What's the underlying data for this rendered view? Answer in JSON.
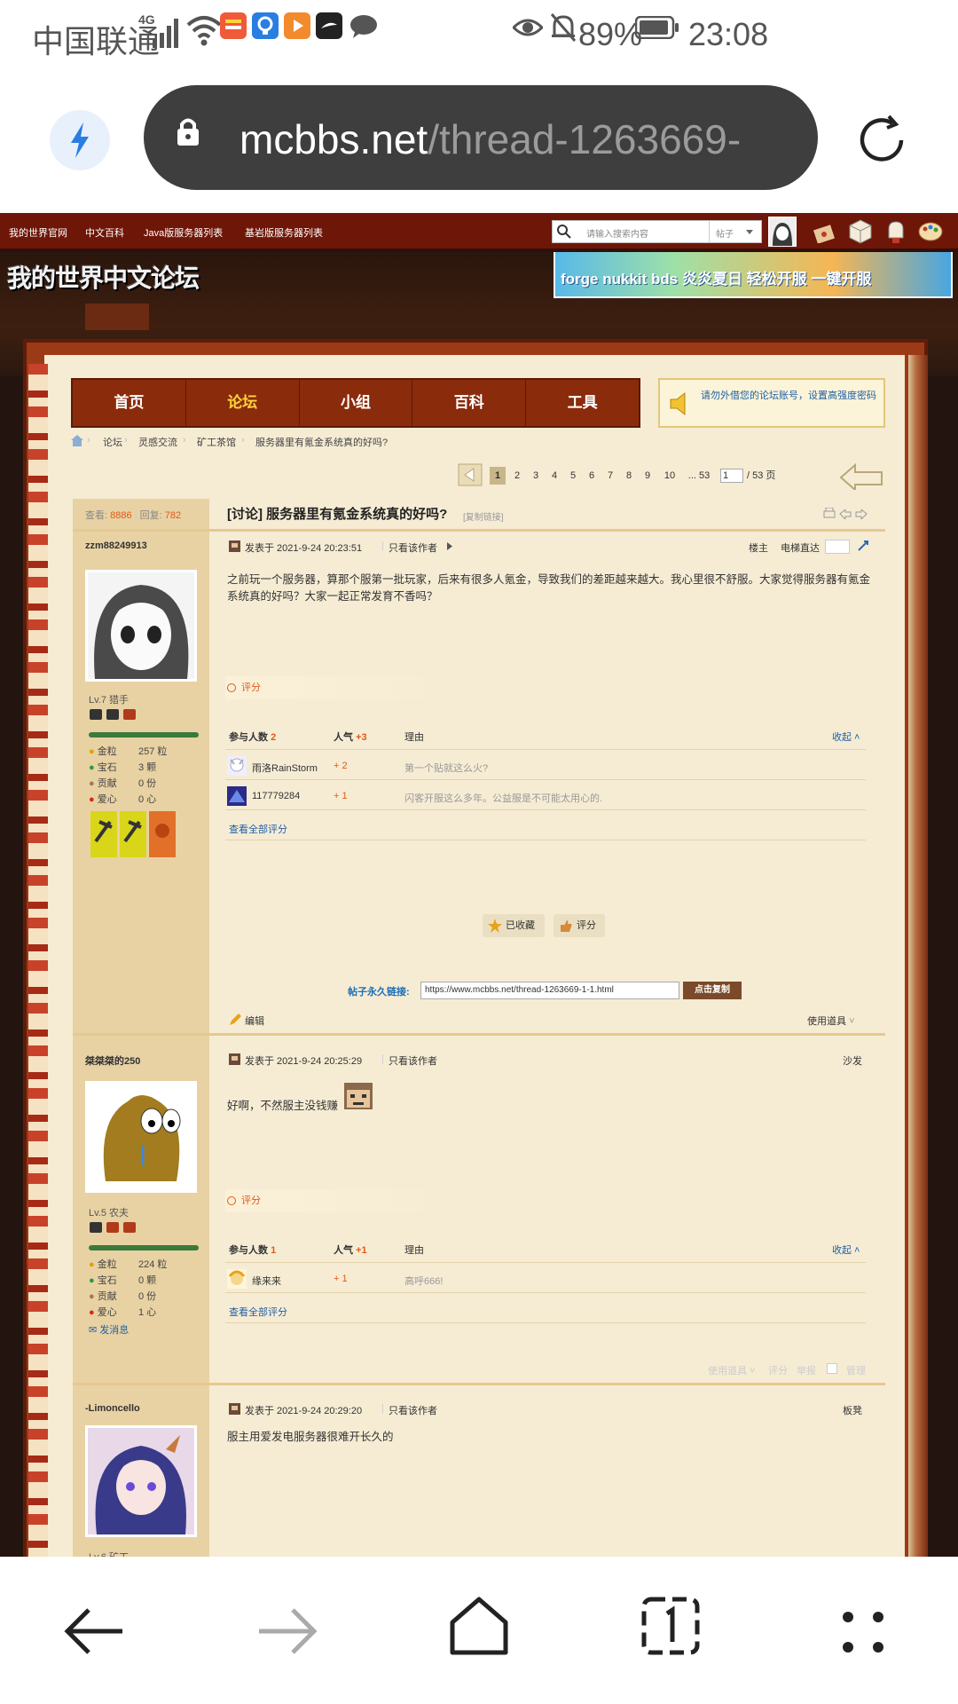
{
  "status_bar": {
    "carrier": "中国联通",
    "network": "4G",
    "battery": "89%",
    "time": "23:08",
    "icons": [
      "signal-icon",
      "wifi-icon",
      "app-icon-red",
      "app-icon-blue",
      "app-icon-orange",
      "app-icon-black",
      "chat-icon",
      "eye-icon",
      "mute-bell-icon",
      "battery-icon"
    ]
  },
  "browser": {
    "url_host": "mcbbs.net",
    "url_path": "/thread-1263669-"
  },
  "site": {
    "top_links": [
      "我的世界官网",
      "中文百科",
      "Java版服务器列表",
      "基岩版服务器列表"
    ],
    "search_placeholder": "请输入搜索内容",
    "search_scope": "帖子",
    "logo_text": "我的世界中文论坛",
    "banner_text": "forge nukkit bds 炎炎夏日 轻松开服 一键开服",
    "menu": [
      "首页",
      "论坛",
      "小组",
      "百科",
      "工具"
    ],
    "active_menu": "论坛",
    "password_tip": "请勿外借您的论坛账号，设置高强度密码",
    "breadcrumb": [
      "论坛",
      "灵感交流",
      "矿工茶馆",
      "服务器里有氪金系统真的好吗?"
    ],
    "pages": [
      "1",
      "2",
      "3",
      "4",
      "5",
      "6",
      "7",
      "8",
      "9",
      "10",
      "... 53"
    ],
    "page_input": "1",
    "page_total": "/ 53 页"
  },
  "thread": {
    "views_label": "查看:",
    "views": "8886",
    "replies_label": "回复:",
    "replies": "782",
    "title": "[讨论] 服务器里有氪金系统真的好吗?",
    "copy_link": "[复制链接]",
    "permalink_label": "帖子永久链接:",
    "permalink": "https://www.mcbbs.net/thread-1263669-1-1.html",
    "copy_button": "点击复制",
    "favorite_button": "已收藏",
    "rate_button": "评分",
    "edit_label": "编辑",
    "use_tool": "使用道具",
    "jump_label": "电梯直达"
  },
  "posts": [
    {
      "author": "zzm88249913",
      "rank": "Lv.7 猎手",
      "stats": [
        {
          "label": "金粒",
          "value": "257 粒"
        },
        {
          "label": "宝石",
          "value": "3 颗"
        },
        {
          "label": "贡献",
          "value": "0 份"
        },
        {
          "label": "爱心",
          "value": "0 心"
        }
      ],
      "meta": "发表于 2021-9-24 20:23:51",
      "only_author": "只看该作者",
      "floor": "楼主",
      "content": "之前玩一个服务器，算那个服第一批玩家，后来有很多人氪金，导致我们的差距越来越大。我心里很不舒服。大家觉得服务器有氪金系统真的好吗？大家一起正常发育不香吗？",
      "rating_title": "评分",
      "rating_cols": [
        "参与人数",
        "人气",
        "理由"
      ],
      "rating_count": "2",
      "rating_pop": "+3",
      "collapse": "收起",
      "ratings": [
        {
          "user": "雨洛RainStorm",
          "pop": "+ 2",
          "reason": "第一个贴就这么火?"
        },
        {
          "user": "117779284",
          "pop": "+ 1",
          "reason": "闪客开服这么多年。公益服是不可能太用心的."
        }
      ],
      "view_all": "查看全部评分"
    },
    {
      "author": "桀桀桀的250",
      "rank": "Lv.5 农夫",
      "stats": [
        {
          "label": "金粒",
          "value": "224 粒"
        },
        {
          "label": "宝石",
          "value": "0 颗"
        },
        {
          "label": "贡献",
          "value": "0 份"
        },
        {
          "label": "爱心",
          "value": "1 心"
        }
      ],
      "send_msg": "发消息",
      "meta": "发表于 2021-9-24 20:25:29",
      "only_author": "只看该作者",
      "floor": "沙发",
      "content": "好啊，不然服主没钱赚",
      "rating_title": "评分",
      "rating_cols": [
        "参与人数",
        "人气",
        "理由"
      ],
      "rating_count": "1",
      "rating_pop": "+1",
      "collapse": "收起",
      "ratings": [
        {
          "user": "缘来来",
          "pop": "+ 1",
          "reason": "高呼666!"
        }
      ],
      "view_all": "查看全部评分",
      "footer_actions": [
        "使用道具",
        "评分",
        "举报",
        "管理"
      ]
    },
    {
      "author": "-Limoncello",
      "rank": "Lv.6 矿工",
      "meta": "发表于 2021-9-24 20:29:20",
      "only_author": "只看该作者",
      "floor": "板凳",
      "content": "服主用爱发电服务器很难开长久的"
    }
  ],
  "colors": {
    "accent": "#8a2b0c",
    "menu_active": "#ffd43b",
    "paper": "#f6ecd4",
    "sidebar": "#e8d2a4",
    "link": "#1f5fa8",
    "orange": "#e05a18"
  }
}
